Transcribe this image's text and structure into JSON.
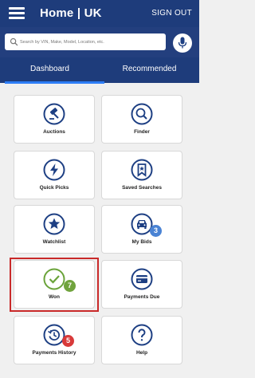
{
  "header": {
    "title": "Home | UK",
    "signout_label": "SIGN OUT"
  },
  "search": {
    "placeholder": "Search by VIN, Make, Model, Location, etc."
  },
  "tabs": [
    {
      "label": "Dashboard",
      "active": true
    },
    {
      "label": "Recommended",
      "active": false
    }
  ],
  "tiles": {
    "auctions": {
      "label": "Auctions",
      "icon": "gavel-icon"
    },
    "finder": {
      "label": "Finder",
      "icon": "magnifier-icon"
    },
    "quick_picks": {
      "label": "Quick Picks",
      "icon": "lightning-icon"
    },
    "saved_searches": {
      "label": "Saved Searches",
      "icon": "bookmark-icon"
    },
    "watchlist": {
      "label": "Watchlist",
      "icon": "star-icon"
    },
    "my_bids": {
      "label": "My Bids",
      "icon": "car-icon",
      "badge": "3"
    },
    "won": {
      "label": "Won",
      "icon": "checkmark-icon",
      "badge": "7"
    },
    "payments_due": {
      "label": "Payments Due",
      "icon": "credit-card-icon"
    },
    "payments_history": {
      "label": "Payments History",
      "icon": "history-clock-icon",
      "badge": "5"
    },
    "help": {
      "label": "Help",
      "icon": "question-icon"
    }
  },
  "colors": {
    "header_bg": "#1e3c7b",
    "icon_blue": "#1d3f83",
    "tab_indicator": "#2d7df6",
    "badge_blue": "#4a83d4",
    "badge_green": "#70a33d",
    "badge_red": "#d83a3a",
    "won_icon": "#6aa33a",
    "highlight": "#c92a2a"
  }
}
